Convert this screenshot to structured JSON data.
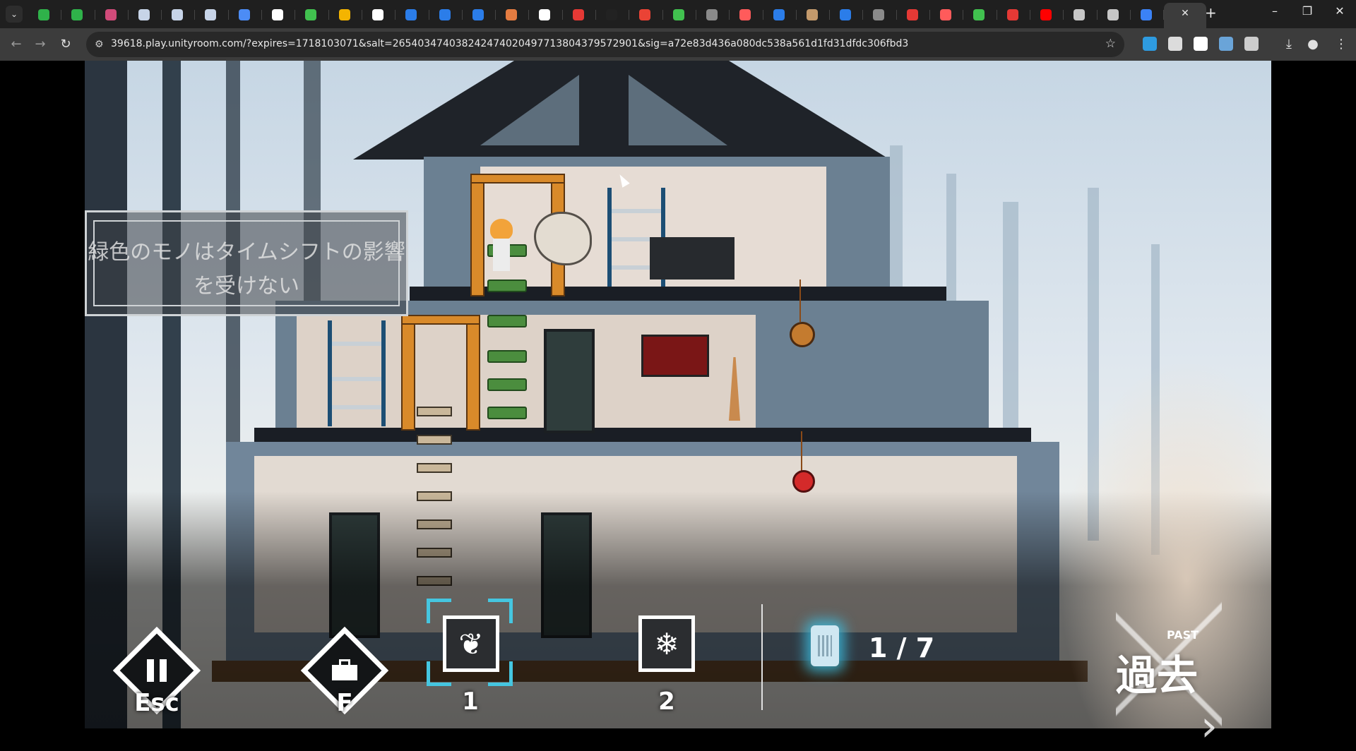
{
  "browser": {
    "tab_count_favicons": [
      "#2fb24a",
      "#2fb24a",
      "#d14b7a",
      "#c7d4e8",
      "#c7d4e8",
      "#c7d4e8",
      "#4c8cf5",
      "#ffffff",
      "#41c14f",
      "#f4b400",
      "#ffffff",
      "#2b7de9",
      "#2b7de9",
      "#2b7de9",
      "#e57c41",
      "#ffffff",
      "#e53935",
      "#222222",
      "#ea4335",
      "#41c14f",
      "#8a8a8a",
      "#ff5b5b",
      "#2b7de9",
      "#c49a6c",
      "#2b7de9",
      "#8a8a8a",
      "#e53935",
      "#ff5b5b",
      "#41c14f",
      "#e53935",
      "#ff0000",
      "#c7c7c7",
      "#c7c7c7",
      "#3b82f6"
    ],
    "url": "39618.play.unityroom.com/?expires=1718103071&salt=265403474038242474020497713804379572901&sig=a72e83d436a080dc538a561d1fd31dfdc306fbd3",
    "extension_colors": [
      "#2e9be0",
      "#dcdcdc",
      "#ffffff",
      "#6aa4d8",
      "#cccccc"
    ]
  },
  "game": {
    "hint_text": "緑色のモノはタイムシフトの影響を受けない",
    "hud": {
      "pause_key": "Esc",
      "inventory_key": "F",
      "skill1_key": "1",
      "skill2_key": "2",
      "counter": "1 / 7",
      "mode_en": "PAST",
      "mode_jp": "過去"
    },
    "colors": {
      "accent_cyan": "#45c6e0",
      "pillar_orange": "#d98a2a",
      "ladder_green": "#4b8d3e",
      "shelf_blue": "#1c4e74"
    }
  }
}
